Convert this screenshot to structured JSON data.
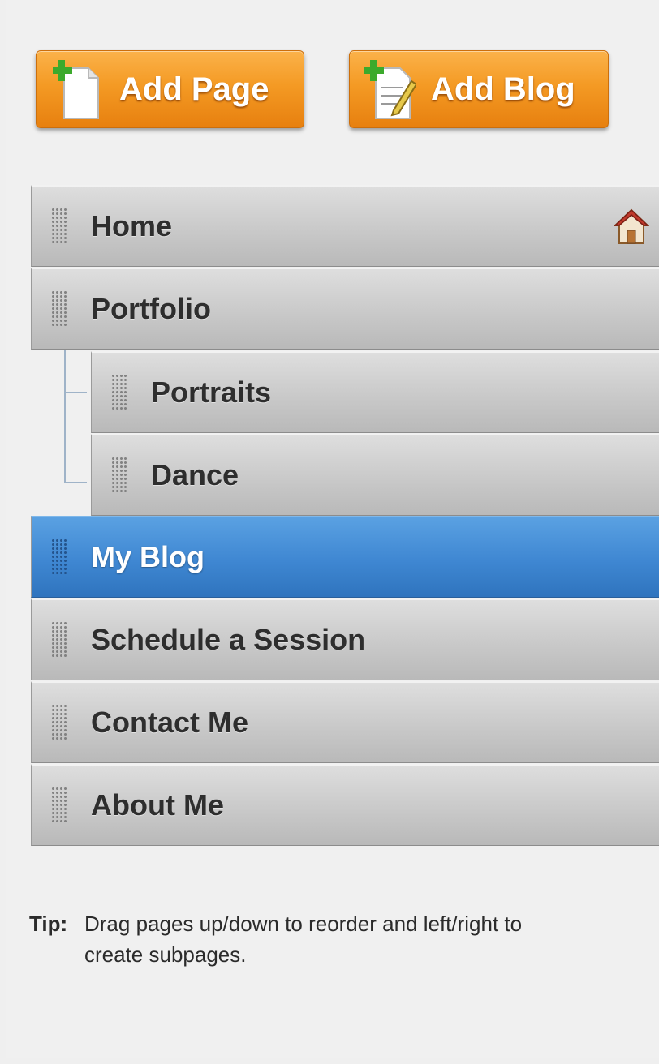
{
  "actions": {
    "add_page_label": "Add Page",
    "add_blog_label": "Add Blog"
  },
  "pages": [
    {
      "label": "Home",
      "level": 0,
      "selected": false,
      "home": true
    },
    {
      "label": "Portfolio",
      "level": 0,
      "selected": false,
      "home": false
    },
    {
      "label": "Portraits",
      "level": 1,
      "selected": false,
      "home": false
    },
    {
      "label": "Dance",
      "level": 1,
      "selected": false,
      "home": false
    },
    {
      "label": "My Blog",
      "level": 0,
      "selected": true,
      "home": false
    },
    {
      "label": "Schedule a Session",
      "level": 0,
      "selected": false,
      "home": false
    },
    {
      "label": "Contact Me",
      "level": 0,
      "selected": false,
      "home": false
    },
    {
      "label": "About Me",
      "level": 0,
      "selected": false,
      "home": false
    }
  ],
  "tip": {
    "label": "Tip:",
    "text": "Drag pages up/down to reorder and left/right to create subpages."
  },
  "icons": {
    "add_page": "add-page-icon",
    "add_blog": "add-blog-icon",
    "home": "home-icon",
    "drag": "drag-handle-icon"
  },
  "colors": {
    "button_orange": "#f49a24",
    "selected_blue": "#3f87d2",
    "row_gray": "#c9c9c9"
  }
}
